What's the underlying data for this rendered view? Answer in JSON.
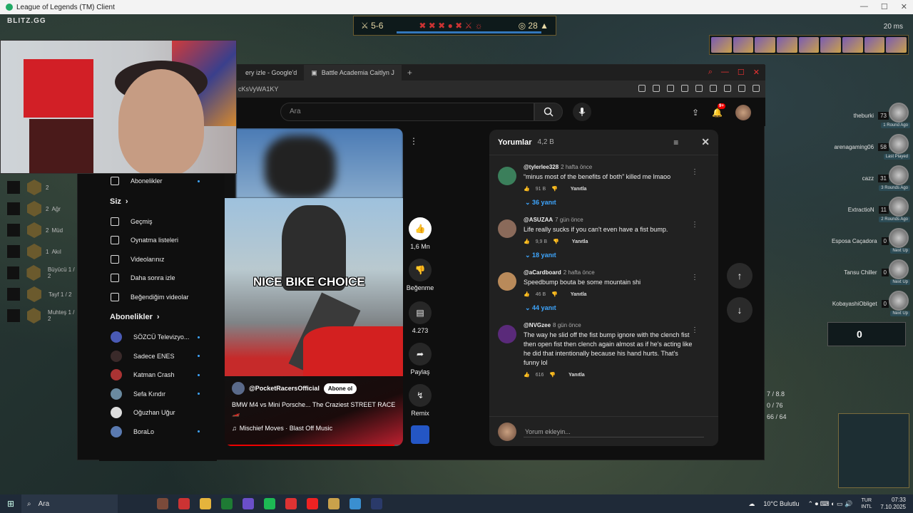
{
  "client": {
    "title": "League of Legends (TM) Client",
    "overlay": "BLITZ.GG",
    "ping": "20 ms"
  },
  "hud": {
    "score": "5-6",
    "gold": "28"
  },
  "scoreboard": [
    {
      "name": "theburki",
      "hp": "73",
      "tag": "1 Round Ago"
    },
    {
      "name": "arenagaming06",
      "hp": "58",
      "tag": "Last Played"
    },
    {
      "name": "cazz",
      "hp": "31",
      "tag": "3 Rounds Ago"
    },
    {
      "name": "ExtractioN",
      "hp": "11",
      "tag": "2 Rounds Ago"
    },
    {
      "name": "Esposa Caçadora",
      "hp": "0",
      "tag": "Next Up"
    },
    {
      "name": "Tansu Chiller",
      "hp": "0",
      "tag": "Next Up"
    },
    {
      "name": "KobayashiObliget",
      "hp": "0",
      "tag": "Next Up"
    }
  ],
  "player_gold": "0",
  "right_stats": {
    "a": "7 / 8.8",
    "b": "0 / 76",
    "c": "66 / 64"
  },
  "left_items": [
    {
      "num": "2",
      "label": ""
    },
    {
      "num": "2",
      "label": "Ağr"
    },
    {
      "num": "2",
      "label": "Müd"
    },
    {
      "num": "1",
      "label": "Akıl"
    },
    {
      "num": "",
      "label": "Büyücü 1 / 2"
    },
    {
      "num": "",
      "label": "Tayf 1 / 2"
    },
    {
      "num": "",
      "label": "Muhteş 1 / 2"
    }
  ],
  "browser": {
    "tabs": [
      {
        "label": "ery izle - Google'd"
      },
      {
        "label": "Battle Academia Caitlyn J"
      }
    ],
    "url": "cKsVyWA1KY"
  },
  "youtube": {
    "search_placeholder": "Ara",
    "notif_count": "9+",
    "sidebar": {
      "subscriptions_label": "Abonelikler",
      "you_section": "Siz",
      "you_items": [
        "Geçmiş",
        "Oynatma listeleri",
        "Videolarınız",
        "Daha sonra izle",
        "Beğendiğim videolar"
      ],
      "subs_section": "Abonelikler",
      "channels": [
        "SÖZCÜ Televizyo...",
        "Sadece ENES",
        "Katman Crash",
        "Sefa Kındır",
        "Oğuzhan Uğur",
        "BoraLo"
      ]
    },
    "short": {
      "caption": "NICE BIKE CHOICE",
      "channel": "@PocketRacersOfficial",
      "subscribe": "Abone ol",
      "title": "BMW M4 vs Mini Porsche... The Craziest STREET RACE 🏎️",
      "music": "Mischief Moves · Blast Off Music",
      "progress": 0.95
    },
    "actions": {
      "likes": "1,6 Mn",
      "dislike": "Beğenme",
      "comments": "4.273",
      "share": "Paylaş",
      "remix": "Remix"
    },
    "comments": {
      "title": "Yorumlar",
      "count": "4,2 B",
      "input_placeholder": "Yorum ekleyin...",
      "reply_label": "Yanıtla",
      "items": [
        {
          "user": "@tylerlee328",
          "time": "2 hafta önce",
          "text": "“minus most of the benefits of both” killed me lmaoo",
          "likes": "91 B",
          "replies": "36 yanıt",
          "color": "#3b7f5b"
        },
        {
          "user": "@ASUZAA",
          "time": "7 gün önce",
          "text": "Life really sucks if you can't even have a fist bump.",
          "likes": "9,9 B",
          "replies": "18 yanıt",
          "color": "#8a6a5a"
        },
        {
          "user": "@aCardboard",
          "time": "2 hafta önce",
          "text": "Speedbump bouta be some mountain shi",
          "likes": "46 B",
          "replies": "44 yanıt",
          "color": "#b98a5a"
        },
        {
          "user": "@NVGzee",
          "time": "8 gün önce",
          "text": "The way he slid off the fist bump ignore with the clench fist then open fist then clench again almost as if he's acting like he did that intentionally because his hand hurts. That's funny lol",
          "likes": "616",
          "replies": "",
          "color": "#5a2a7a"
        }
      ]
    }
  },
  "taskbar": {
    "search": "Ara",
    "weather": "10°C  Bulutlu",
    "lang_top": "TUR",
    "lang_bottom": "INTL",
    "time": "07:33",
    "date": "7.10.2025"
  }
}
